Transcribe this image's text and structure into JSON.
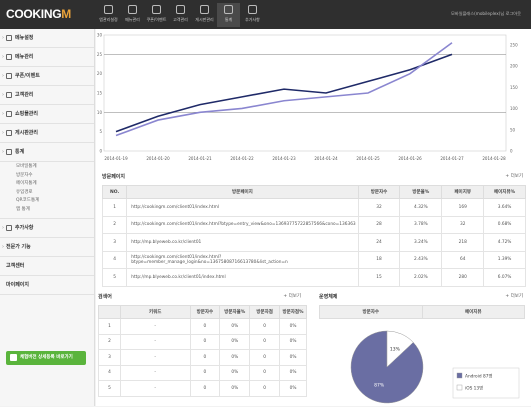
{
  "app": {
    "logo_main": "COOKING",
    "logo_accent": "M",
    "user_info": "모바일플래스(mobileplex)님 로그아웃"
  },
  "topnav": [
    {
      "label": "앱관리설정",
      "icon": "gear-icon",
      "active": false
    },
    {
      "label": "메뉴관리",
      "icon": "grid-icon",
      "active": false
    },
    {
      "label": "쿠폰/이벤트",
      "icon": "tag-icon",
      "active": false
    },
    {
      "label": "고객관리",
      "icon": "people-icon",
      "active": false
    },
    {
      "label": "게시판관리",
      "icon": "board-icon",
      "active": false
    },
    {
      "label": "통계",
      "icon": "chart-icon",
      "active": true
    },
    {
      "label": "추가사항",
      "icon": "plus-icon",
      "active": false
    }
  ],
  "sidebar": {
    "items": [
      {
        "label": "메뉴설정"
      },
      {
        "label": "메뉴관리"
      },
      {
        "label": "쿠폰/이벤트"
      },
      {
        "label": "고객관리"
      },
      {
        "label": "쇼핑몰관리"
      },
      {
        "label": "게시판관리"
      },
      {
        "label": "통계"
      }
    ],
    "stats_sub": [
      "모바일통계",
      "방문자수",
      "페이지통계",
      "유입경로",
      "QR코드통계",
      "앱 통계"
    ],
    "lower_items": [
      {
        "label": "추가사항"
      },
      {
        "label": "전문가 기능"
      },
      {
        "label": "고객센터"
      },
      {
        "label": "마이페이지"
      }
    ],
    "banner": "체험버전 상세등록 바로가기"
  },
  "chart_data": {
    "type": "line",
    "x": [
      "2014-01-19",
      "2014-01-20",
      "2014-01-21",
      "2014-01-22",
      "2014-01-23",
      "2014-01-24",
      "2014-01-25",
      "2014-01-26",
      "2014-01-27",
      "2014-01-28"
    ],
    "yleft_ticks": [
      0,
      5,
      10,
      15,
      20,
      25,
      30
    ],
    "yright_ticks": [
      0,
      50,
      100,
      150,
      200,
      250
    ],
    "series": [
      {
        "values": [
          5,
          9,
          12,
          14,
          16,
          15,
          18,
          21,
          25,
          null
        ],
        "color": "#1f2a68"
      },
      {
        "values": [
          4,
          8,
          10,
          11,
          13,
          14,
          15,
          20,
          28,
          null
        ],
        "color": "#8a86d0"
      }
    ],
    "reference_lines": [
      10,
      25
    ],
    "grid": false,
    "legend": "none"
  },
  "visit_section": {
    "title": "방문페이지",
    "more": "+ 더보기",
    "headers": [
      "NO.",
      "방문페이지",
      "방문자수",
      "방문율%",
      "페이지뷰",
      "페이지뷰%"
    ],
    "rows": [
      [
        "1",
        "http://cookingm.com/client01/index.html",
        "32",
        "4.32%",
        "169",
        "3.64%"
      ],
      [
        "2",
        "http://cookingm.com/client01/index.html?btype=entry_view&ono=13693775722857566&cono=136363",
        "28",
        "3.78%",
        "32",
        "0.68%"
      ],
      [
        "3",
        "http://mp.blyeweb.co.kr/client01",
        "24",
        "3.24%",
        "218",
        "4.72%"
      ],
      [
        "4",
        "http://cookingm.com/client01/index.html?btype=member_manage_login&no=13675808716613780&list_action=n",
        "18",
        "2.43%",
        "64",
        "1.39%"
      ],
      [
        "5",
        "http://mp.blyeweb.co.kr/client01/index.html",
        "15",
        "2.02%",
        "280",
        "6.07%"
      ]
    ]
  },
  "keyword_section": {
    "title": "검색어",
    "more": "+ 더보기",
    "headers": [
      "",
      "키워드",
      "방문자수",
      "방문자율%",
      "방문자점",
      "방문자점%"
    ],
    "rows": [
      [
        "1",
        "-",
        "0",
        "0%",
        "0",
        "0%"
      ],
      [
        "2",
        "-",
        "0",
        "0%",
        "0",
        "0%"
      ],
      [
        "3",
        "-",
        "0",
        "0%",
        "0",
        "0%"
      ],
      [
        "4",
        "-",
        "0",
        "0%",
        "0",
        "0%"
      ],
      [
        "5",
        "-",
        "0",
        "0%",
        "0",
        "0%"
      ]
    ]
  },
  "os_section": {
    "title": "운영체제",
    "more": "+ 더보기",
    "headers": [
      "방문자수",
      "페이지뷰"
    ],
    "pie": [
      {
        "label": "Android 87명",
        "value": 87,
        "pct_label": "87%",
        "color": "#6a6ea3"
      },
      {
        "label": "iOS 13명",
        "value": 13,
        "pct_label": "13%",
        "color": "#ffffff"
      }
    ]
  }
}
